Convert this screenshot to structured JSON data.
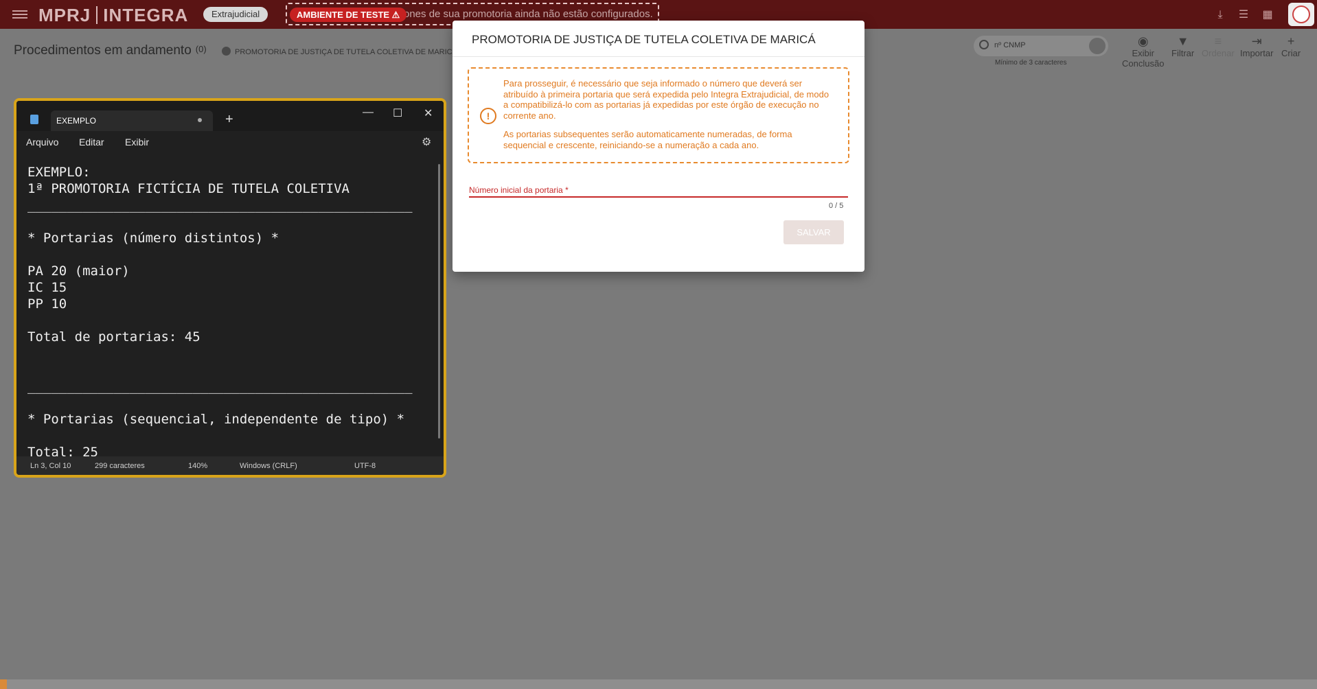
{
  "topbar": {
    "logo_left": "MPRJ",
    "logo_right": "INTEGRA",
    "module_chip": "Extrajudicial",
    "test_badge": "AMBIENTE DE TESTE ⚠",
    "test_scroll_text": "ones de sua promotoria ainda não estão configurados."
  },
  "subheader": {
    "title": "Procedimentos em andamento",
    "count": "(0)",
    "promotoria": "PROMOTORIA DE JUSTIÇA DE TUTELA COLETIVA DE MARICÁ",
    "search_placeholder": "nº CNMP",
    "search_hint": "Mínimo de 3 caracteres",
    "actions": {
      "conclusao_l1": "Exibir",
      "conclusao_l2": "Conclusão",
      "filtrar": "Filtrar",
      "ordenar": "Ordenar",
      "importar": "Importar",
      "criar": "Criar"
    }
  },
  "modal": {
    "title": "PROMOTORIA DE JUSTIÇA DE TUTELA COLETIVA DE MARICÁ",
    "warning_p1": "Para prosseguir, é necessário que seja informado o número que deverá ser atribuído à primeira portaria que será expedida pelo Integra Extrajudicial, de modo a compatibilizá-lo com as portarias já expedidas por este órgão de execução no corrente ano.",
    "warning_p2": "As portarias subsequentes serão automaticamente numeradas, de forma sequencial e crescente, reiniciando-se a numeração a cada ano.",
    "field_label": "Número inicial da portaria *",
    "field_value": "",
    "counter": "0 / 5",
    "save_label": "SALVAR"
  },
  "notepad": {
    "tab_title": "EXEMPLO",
    "menu": {
      "arquivo": "Arquivo",
      "editar": "Editar",
      "exibir": "Exibir"
    },
    "lines": [
      "EXEMPLO:",
      "1ª PROMOTORIA FICTÍCIA DE TUTELA COLETIVA",
      "_________________________________________________",
      "",
      "* Portarias (número distintos) *",
      "",
      "PA 20 (maior)",
      "IC 15",
      "PP 10",
      "",
      "Total de portarias: 45",
      "",
      "",
      "_________________________________________________",
      "",
      "* Portarias (sequencial, independente de tipo) *",
      "",
      "Total: 25"
    ],
    "status": {
      "position": "Ln 3, Col 10",
      "chars": "299 caracteres",
      "zoom": "140%",
      "line_ending": "Windows (CRLF)",
      "encoding": "UTF-8"
    }
  }
}
